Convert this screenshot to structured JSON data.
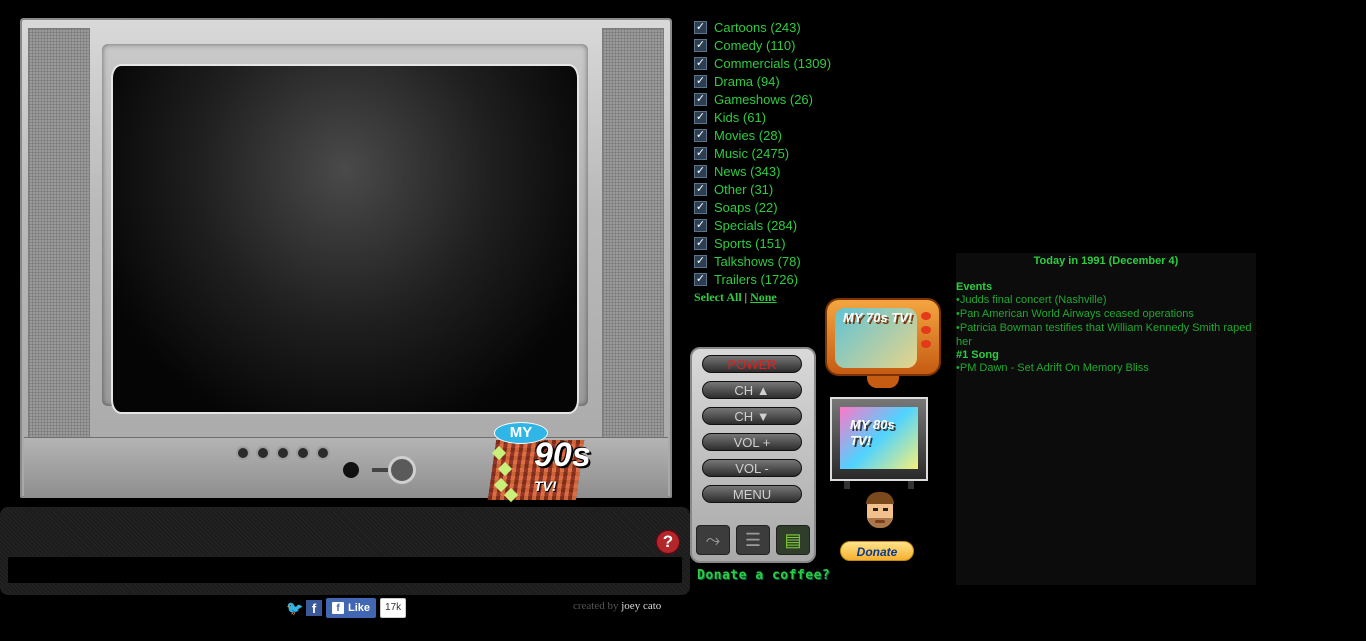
{
  "categories": [
    {
      "label": "Cartoons (243)",
      "checked": true
    },
    {
      "label": "Comedy (110)",
      "checked": true
    },
    {
      "label": "Commercials (1309)",
      "checked": true
    },
    {
      "label": "Drama (94)",
      "checked": true
    },
    {
      "label": "Gameshows (26)",
      "checked": true
    },
    {
      "label": "Kids (61)",
      "checked": true
    },
    {
      "label": "Movies (28)",
      "checked": true
    },
    {
      "label": "Music (2475)",
      "checked": true
    },
    {
      "label": "News (343)",
      "checked": true
    },
    {
      "label": "Other (31)",
      "checked": true
    },
    {
      "label": "Soaps (22)",
      "checked": true
    },
    {
      "label": "Specials (284)",
      "checked": true
    },
    {
      "label": "Sports (151)",
      "checked": true
    },
    {
      "label": "Talkshows (78)",
      "checked": true
    },
    {
      "label": "Trailers (1726)",
      "checked": true
    }
  ],
  "select": {
    "all": "Select All",
    "separator": "|",
    "none": "None"
  },
  "remote": {
    "power": "POWER",
    "ch_up": "CH ▲",
    "ch_down": "CH ▼",
    "vol_up": "VOL +",
    "vol_down": "VOL -",
    "menu": "MENU"
  },
  "donate_coffee": "Donate a coffee?",
  "donate_button": "Donate",
  "logos": {
    "tv90_top": "MY",
    "tv90_num": "90s",
    "tv90_bottom": "TV!",
    "tv70": "MY 70s TV!",
    "tv80": "MY 80s TV!"
  },
  "help": "?",
  "social": {
    "like": "Like",
    "like_count": "17k"
  },
  "credits": {
    "prefix": "created by",
    "name": "joey cato"
  },
  "today": {
    "title": "Today in 1991 (December 4)",
    "events_heading": "Events",
    "events": [
      "•Judds final concert (Nashville)",
      "•Pan American World Airways ceased operations",
      "•Patricia Bowman testifies that William Kennedy Smith raped her"
    ],
    "song_heading": "#1 Song",
    "song": "•PM Dawn - Set Adrift On Memory Bliss"
  },
  "colors": {
    "accent_green": "#2ecc40",
    "power_red": "#e02020"
  }
}
